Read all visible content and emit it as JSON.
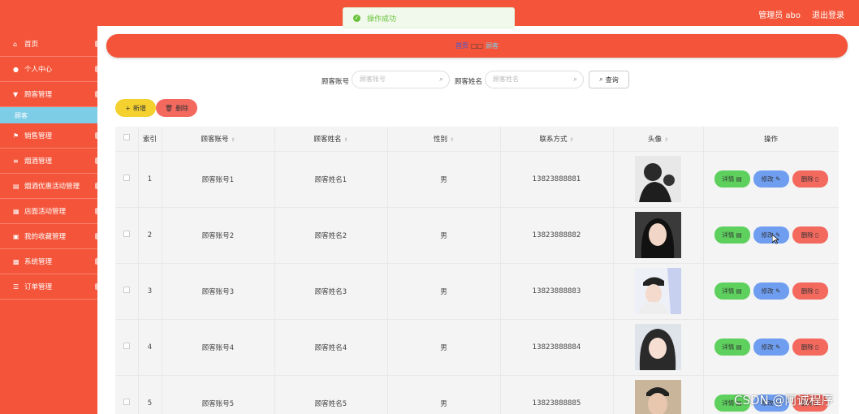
{
  "header": {
    "admin_label": "管理员 abo",
    "logout_label": "退出登录"
  },
  "toast": {
    "message": "操作成功"
  },
  "sidebar": {
    "items": [
      {
        "label": "首页",
        "icon": "home-icon",
        "glyph": "⌂"
      },
      {
        "label": "个人中心",
        "icon": "user-icon",
        "glyph": "●"
      },
      {
        "label": "顾客管理",
        "icon": "filter-icon",
        "glyph": "▼"
      },
      {
        "label": "销售管理",
        "icon": "flag-icon",
        "glyph": "⚑"
      },
      {
        "label": "烟酒管理",
        "icon": "layers-icon",
        "glyph": "≡"
      },
      {
        "label": "烟酒优惠活动管理",
        "icon": "list-icon",
        "glyph": "▤"
      },
      {
        "label": "店面活动管理",
        "icon": "grid-icon",
        "glyph": "▦"
      },
      {
        "label": "我的收藏管理",
        "icon": "box-icon",
        "glyph": "▣"
      },
      {
        "label": "系统管理",
        "icon": "settings-icon",
        "glyph": "▩"
      },
      {
        "label": "订单管理",
        "icon": "menu-icon",
        "glyph": "☰"
      }
    ],
    "submenu": {
      "label": "顾客"
    }
  },
  "breadcrumb": {
    "home": "首页",
    "separator": "□□",
    "current": "顾客"
  },
  "search": {
    "account_label": "顾客账号",
    "account_placeholder": "顾客账号",
    "name_label": "顾客姓名",
    "name_placeholder": "顾客姓名",
    "query_label": "查询"
  },
  "actions": {
    "add_label": "新增",
    "delete_label": "删除"
  },
  "table": {
    "headers": {
      "index": "索引",
      "account": "顾客账号",
      "name": "顾客姓名",
      "gender": "性别",
      "contact": "联系方式",
      "avatar": "头像",
      "ops": "操作"
    },
    "ops": {
      "detail": "详情",
      "edit": "修改",
      "delete": "删除"
    },
    "rows": [
      {
        "index": "1",
        "account": "顾客账号1",
        "name": "顾客姓名1",
        "gender": "男",
        "contact": "13823888881"
      },
      {
        "index": "2",
        "account": "顾客账号2",
        "name": "顾客姓名2",
        "gender": "男",
        "contact": "13823888882"
      },
      {
        "index": "3",
        "account": "顾客账号3",
        "name": "顾客姓名3",
        "gender": "男",
        "contact": "13823888883"
      },
      {
        "index": "4",
        "account": "顾客账号4",
        "name": "顾客姓名4",
        "gender": "男",
        "contact": "13823888884"
      },
      {
        "index": "5",
        "account": "顾客账号5",
        "name": "顾客姓名5",
        "gender": "男",
        "contact": "13823888885"
      }
    ]
  },
  "colors": {
    "primary": "#f4553a",
    "submenu": "#7ecde6",
    "detail": "#5ed05e",
    "edit": "#6f9ef1",
    "delete": "#f3695e",
    "add": "#f5d130"
  },
  "watermark": "CSDN @阿诚程序"
}
